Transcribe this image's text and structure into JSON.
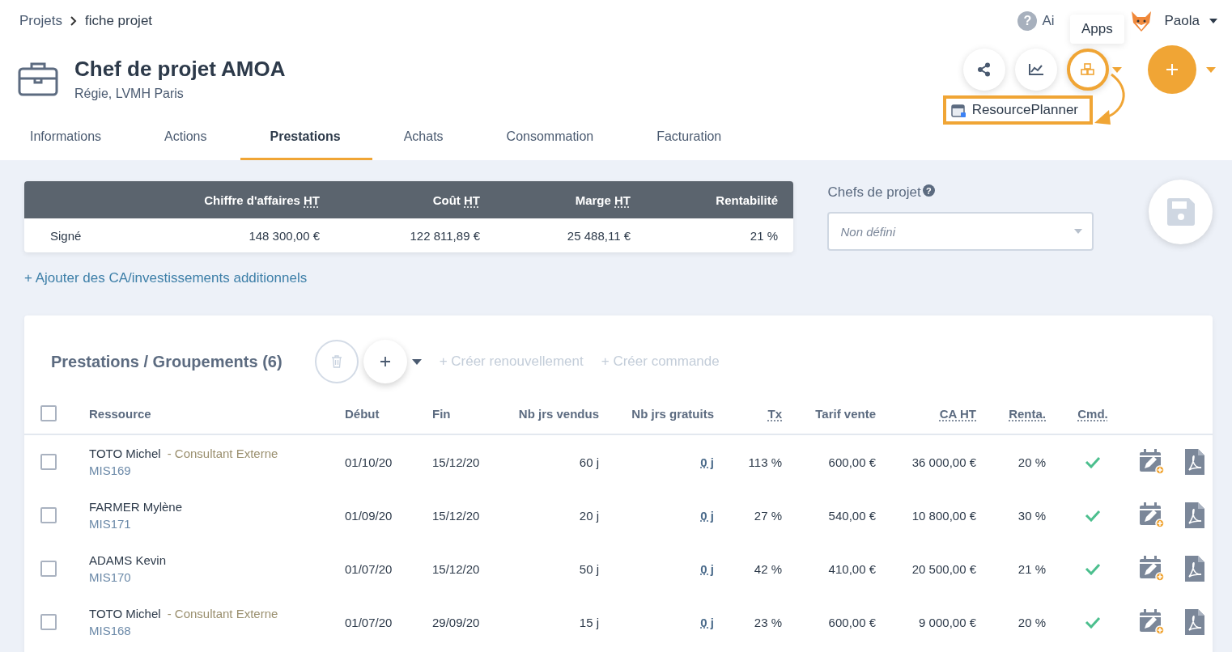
{
  "breadcrumb": [
    "Projets",
    "fiche projet"
  ],
  "topbar": {
    "help_icon": "?",
    "help": "Ai",
    "user": "Paola",
    "tooltip": "Apps"
  },
  "project": {
    "title": "Chef de projet AMOA",
    "subtitle": "Régie, LVMH Paris"
  },
  "apps_menu": {
    "item": "ResourcePlanner"
  },
  "tabs": [
    {
      "label": "Informations",
      "selected": false
    },
    {
      "label": "Actions",
      "selected": false
    },
    {
      "label": "Prestations",
      "selected": true
    },
    {
      "label": "Achats",
      "selected": false
    },
    {
      "label": "Consommation",
      "selected": false
    },
    {
      "label": "Facturation",
      "selected": false
    }
  ],
  "summary": {
    "columns": [
      {
        "label": "Chiffre d'affaires",
        "abbr": "HT"
      },
      {
        "label": "Coût",
        "abbr": "HT"
      },
      {
        "label": "Marge",
        "abbr": "HT"
      },
      {
        "label": "Rentabilité"
      }
    ],
    "row": {
      "label": "Signé",
      "values": [
        "148 300,00 €",
        "122 811,89 €",
        "25 488,11 €",
        "21 %"
      ]
    }
  },
  "chefs": {
    "label": "Chefs de projet",
    "help_icon": "?",
    "placeholder": "Non défini"
  },
  "add_link": "+ Ajouter des CA/investissements additionnels",
  "prestations": {
    "select_all": {
      "checked": false
    },
    "title": "Prestations / Groupements (6)",
    "actions": [
      "+ Créer renouvellement",
      "+ Créer commande"
    ],
    "columns": [
      {
        "label": "Ressource",
        "abbr": false
      },
      {
        "label": "Début",
        "abbr": false
      },
      {
        "label": "Fin",
        "abbr": false
      },
      {
        "label": "Nb jrs vendus",
        "abbr": false
      },
      {
        "label": "Nb jrs gratuits",
        "abbr": false
      },
      {
        "label": "Tx",
        "abbr": true
      },
      {
        "label": "Tarif vente",
        "abbr": false
      },
      {
        "label": "CA HT",
        "abbr": true
      },
      {
        "label": "Renta.",
        "abbr": true
      },
      {
        "label": "Cmd.",
        "abbr": true
      }
    ],
    "rows": [
      {
        "checked": false,
        "name": "TOTO Michel",
        "role": "- Consultant Externe",
        "code": "MIS169",
        "debut": "01/10/20",
        "fin": "15/12/20",
        "vendus": "60 j",
        "gratuits": "0 j",
        "tx": "113 %",
        "tarif": "600,00 €",
        "ca": "36 000,00 €",
        "renta": "20 %",
        "cmd": true
      },
      {
        "checked": false,
        "name": "FARMER Mylène",
        "code": "MIS171",
        "debut": "01/09/20",
        "fin": "15/12/20",
        "vendus": "20 j",
        "gratuits": "0 j",
        "tx": "27 %",
        "tarif": "540,00 €",
        "ca": "10 800,00 €",
        "renta": "30 %",
        "cmd": true
      },
      {
        "checked": false,
        "name": "ADAMS Kevin",
        "code": "MIS170",
        "debut": "01/07/20",
        "fin": "15/12/20",
        "vendus": "50 j",
        "gratuits": "0 j",
        "tx": "42 %",
        "tarif": "410,00 €",
        "ca": "20 500,00 €",
        "renta": "21 %",
        "cmd": true
      },
      {
        "checked": false,
        "name": "TOTO Michel",
        "role": "- Consultant Externe",
        "code": "MIS168",
        "debut": "01/07/20",
        "fin": "29/09/20",
        "vendus": "15 j",
        "gratuits": "0 j",
        "tx": "23 %",
        "tarif": "600,00 €",
        "ca": "9 000,00 €",
        "renta": "20 %",
        "cmd": true
      }
    ]
  }
}
